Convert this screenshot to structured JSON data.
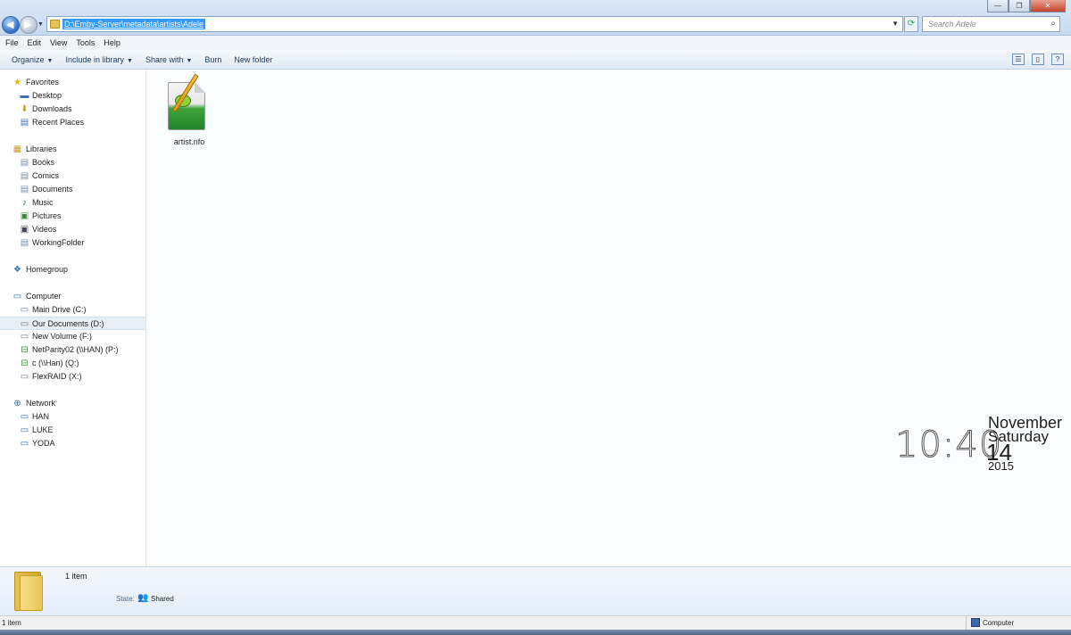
{
  "address": {
    "path": "D:\\Emby-Server\\metadata\\artists\\Adele"
  },
  "search": {
    "placeholder": "Search Adele"
  },
  "window": {
    "minimize": "—",
    "maximize": "❐",
    "close": "✕"
  },
  "menu": [
    "File",
    "Edit",
    "View",
    "Tools",
    "Help"
  ],
  "toolbar": {
    "organize": "Organize",
    "include": "Include in library",
    "share": "Share with",
    "burn": "Burn",
    "new_folder": "New folder"
  },
  "sidebar": {
    "favorites": {
      "label": "Favorites",
      "items": [
        "Desktop",
        "Downloads",
        "Recent Places"
      ]
    },
    "libraries": {
      "label": "Libraries",
      "items": [
        "Books",
        "Comics",
        "Documents",
        "Music",
        "Pictures",
        "Videos",
        "WorkingFolder"
      ]
    },
    "homegroup": {
      "label": "Homegroup"
    },
    "computer": {
      "label": "Computer",
      "items": [
        "Main Drive (C:)",
        "Our Documents (D:)",
        "New Volume (F:)",
        "NetParity02 (\\\\HAN) (P:)",
        "c (\\\\Han) (Q:)",
        "FlexRAID (X:)"
      ]
    },
    "network": {
      "label": "Network",
      "items": [
        "HAN",
        "LUKE",
        "YODA"
      ]
    }
  },
  "files": [
    {
      "name": "artist.nfo"
    }
  ],
  "clock": {
    "time": "10:40",
    "month": "November",
    "weekday": "Saturday",
    "day": "14",
    "year": "2015"
  },
  "details": {
    "count": "1 item",
    "state_label": "State:",
    "state_value": "Shared"
  },
  "status": {
    "left": "1 item",
    "right": "Computer"
  },
  "colors": {
    "selection": "#3399ff",
    "toolbar_text": "#1e395b"
  }
}
